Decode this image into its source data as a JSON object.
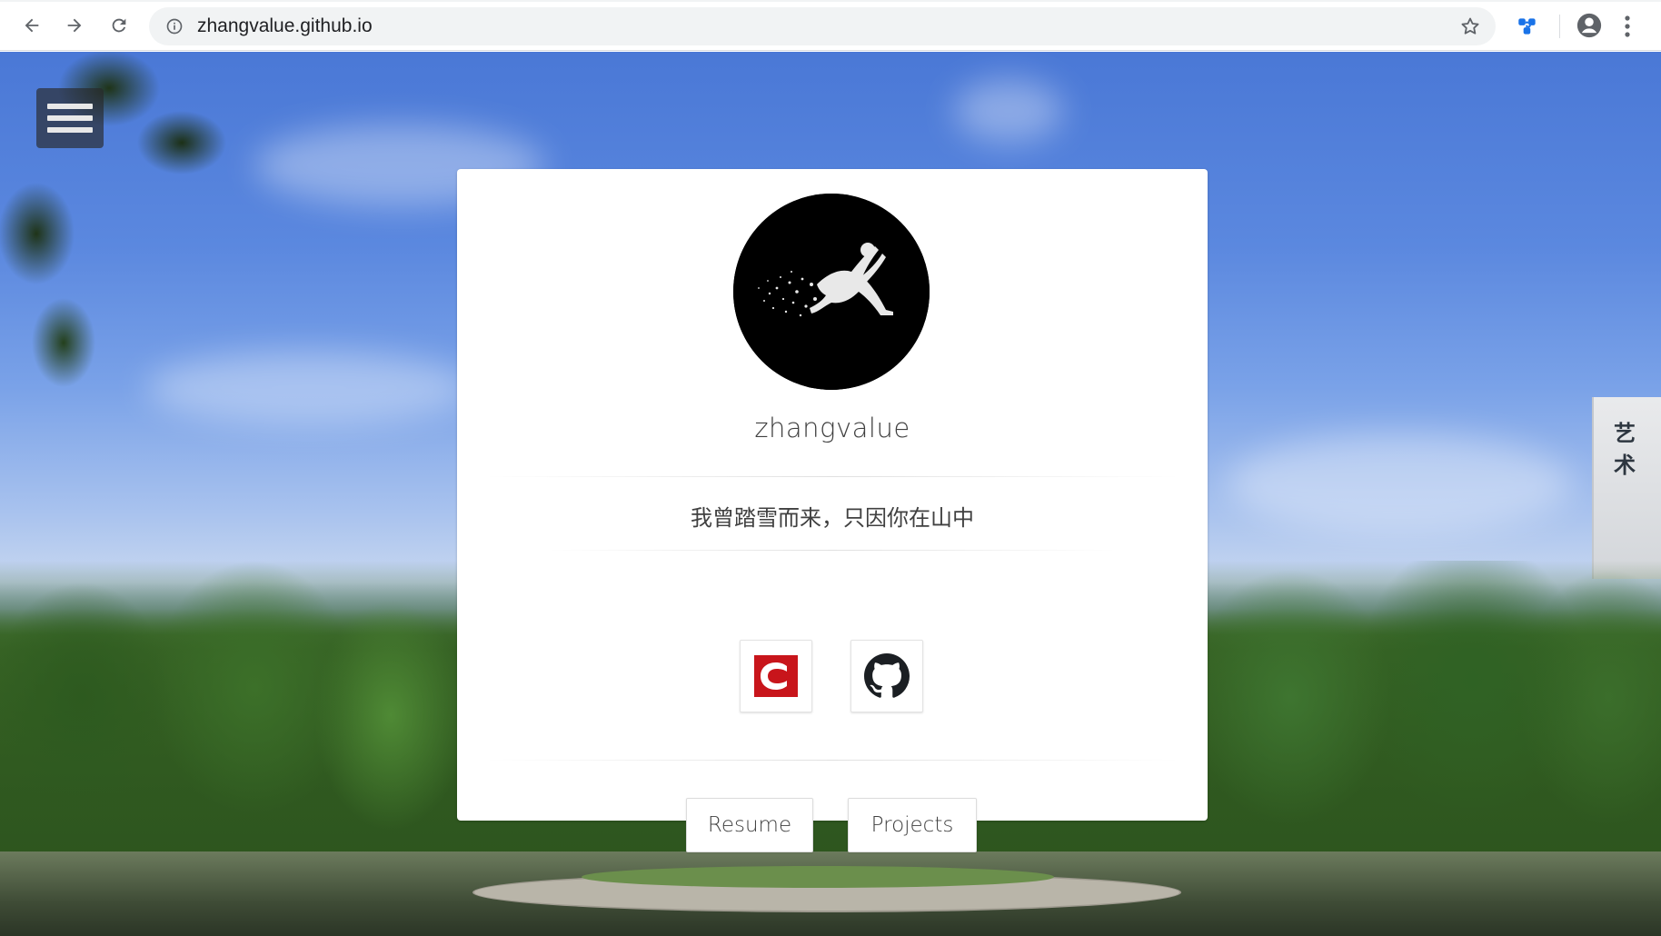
{
  "browser": {
    "url": "zhangvalue.github.io"
  },
  "profile": {
    "username": "zhangvalue",
    "motto": "我曾踏雪而来，只因你在山中",
    "social": [
      {
        "name": "csdn",
        "icon": "csdn-icon"
      },
      {
        "name": "github",
        "icon": "github-icon"
      }
    ],
    "links": {
      "resume": "Resume",
      "projects": "Projects"
    }
  },
  "background": {
    "building_sign": "艺 术"
  },
  "colors": {
    "csdn_red": "#c8151b",
    "sky_blue": "#4a78d6",
    "card_bg": "#ffffff"
  }
}
